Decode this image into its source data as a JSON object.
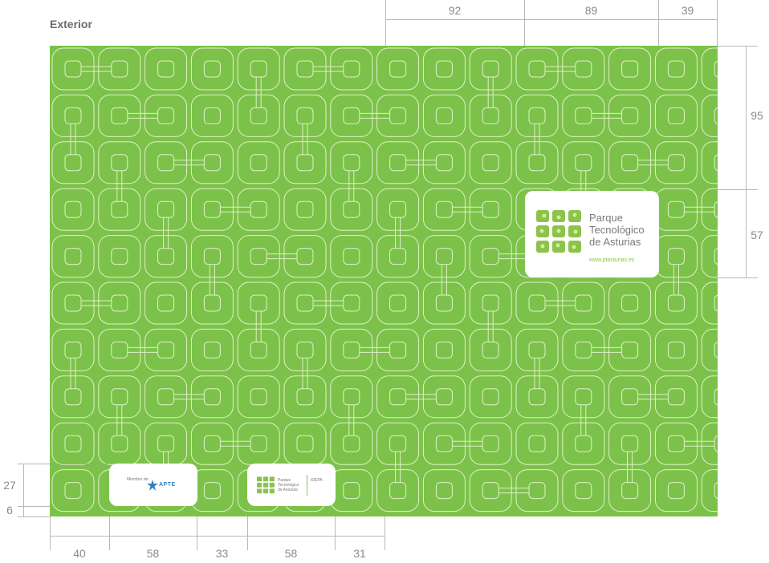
{
  "title": "Exterior",
  "top_dims": [
    "92",
    "89",
    "39"
  ],
  "right_dims": [
    "95",
    "57"
  ],
  "left_dims": [
    "27",
    "6"
  ],
  "bottom_dims": [
    "40",
    "58",
    "33",
    "58",
    "31"
  ],
  "colors": {
    "panel": "#7cc24a",
    "tile_stroke": "#dff0c6",
    "logo_green": "#8cc34a"
  },
  "logo_main": {
    "line1": "Parque",
    "line2": "Tecnológico",
    "line3": "de Asturias",
    "url": "www.ptasturias.es"
  },
  "card_apte": {
    "caption": "Miembro de:",
    "brand": "APTE"
  },
  "card_small": {
    "line1": "Parque",
    "line2": "Tecnológico",
    "line3": "de Asturias",
    "partner": "IDEPA"
  }
}
